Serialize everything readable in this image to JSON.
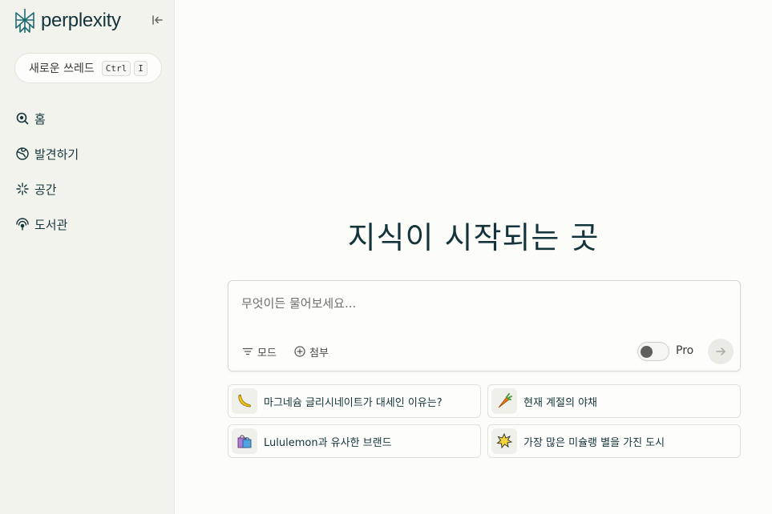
{
  "app": {
    "logo_text": "perplexity"
  },
  "sidebar": {
    "new_thread_label": "새로운 쓰레드",
    "shortcut_keys": [
      "Ctrl",
      "I"
    ],
    "items": [
      {
        "label": "홈",
        "icon": "search-home-icon"
      },
      {
        "label": "발견하기",
        "icon": "globe-icon"
      },
      {
        "label": "공간",
        "icon": "sparkle-icon"
      },
      {
        "label": "도서관",
        "icon": "library-icon"
      }
    ]
  },
  "main": {
    "headline": "지식이 시작되는 곳",
    "ask": {
      "placeholder": "무엇이든 물어보세요...",
      "mode_label": "모드",
      "attach_label": "첨부",
      "pro_label": "Pro",
      "pro_enabled": false
    },
    "suggestions": [
      {
        "label": "마그네슘 글리시네이트가 대세인 이유는?",
        "icon": "banana-emoji-icon"
      },
      {
        "label": "현재 계절의 야채",
        "icon": "carrot-emoji-icon"
      },
      {
        "label": "Lululemon과 유사한 브랜드",
        "icon": "shopping-bags-emoji-icon"
      },
      {
        "label": "가장 많은 미슐랭 별을 가진 도시",
        "icon": "star-burst-emoji-icon"
      }
    ]
  },
  "colors": {
    "sidebar_bg": "#f3f3ee",
    "main_bg": "#fcfcf9",
    "text": "#13343b",
    "brand": "#1f6b73"
  }
}
